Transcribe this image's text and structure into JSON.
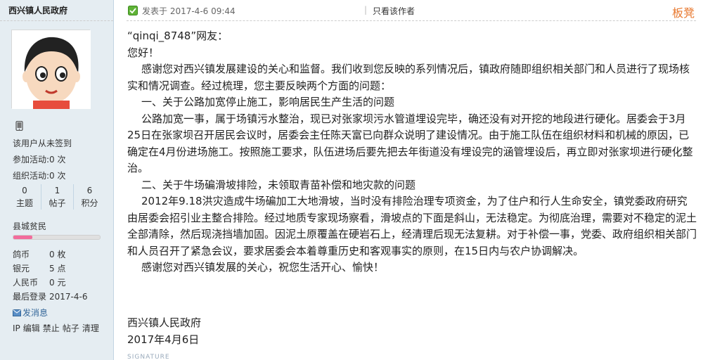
{
  "sidebar": {
    "username": "西兴镇人民政府",
    "signin_text": "该用户从未签到",
    "activity_join": "参加活动:0 次",
    "activity_org": "组织活动:0 次",
    "stats": [
      {
        "num": "0",
        "label": "主题"
      },
      {
        "num": "1",
        "label": "帖子"
      },
      {
        "num": "6",
        "label": "积分"
      }
    ],
    "rank_name": "县城贫民",
    "rank_progress": 0.22,
    "rank_color": "#f26c9c",
    "currency": [
      {
        "k": "鸽币",
        "v": "0 枚"
      },
      {
        "k": "银元",
        "v": "5 点"
      },
      {
        "k": "人民币",
        "v": "0 元"
      }
    ],
    "last_login_label": "最后登录",
    "last_login_value": "2017-4-6",
    "send_message": "发消息",
    "admin_links": [
      "IP",
      "编辑",
      "禁止",
      "帖子",
      "清理"
    ]
  },
  "post": {
    "time": "发表于 2017-4-6 09:44",
    "separator": "|",
    "author_only": "只看该作者",
    "floor": "板凳",
    "paragraphs": [
      "“qinqi_8748”网友：",
      "您好！",
      "感谢您对西兴镇发展建设的关心和监督。我们收到您反映的系列情况后，镇政府随即组织相关部门和人员进行了现场核实和情况调查。经过梳理，您主要反映两个方面的问题：",
      "一、关于公路加宽停止施工，影响居民生产生活的问题",
      "公路加宽一事，属于场镇污水整治，现已对张家坝污水管道埋设完毕，确还没有对开挖的地段进行硬化。居委会于3月25日在张家坝召开居民会议时，居委会主任陈天富已向群众说明了建设情况。由于施工队伍在组织材料和机械的原因，已确定在4月份进场施工。按照施工要求，队伍进场后要先把去年街道没有埋设完的涵管埋设后，再立即对张家坝进行硬化整治。",
      "二、关于牛场碥滑坡排险，未领取青苗补偿和地灾款的问题",
      "2012年9.18洪灾造成牛场碥加工大地滑坡，当时没有排险治理专项资金，为了住户和行人生命安全，镇党委政府研究由居委会招引业主整合排险。经过地质专家现场察看，滑坡点的下面是斜山，无法稳定。为彻底治理，需要对不稳定的泥土全部清除，然后现浇挡墙加固。因泥土原覆盖在硬岩石上，经清理后现无法复耕。对于补偿一事，党委、政府组织相关部门和人员召开了紧急会议，要求居委会本着尊重历史和客观事实的原则，在15日内与农户协调解决。",
      "感谢您对西兴镇发展的关心，祝您生活开心、愉快！"
    ],
    "sign_org": "西兴镇人民政府",
    "sign_date": "2017年4月6日",
    "signature_label": "SIGNATURE"
  }
}
